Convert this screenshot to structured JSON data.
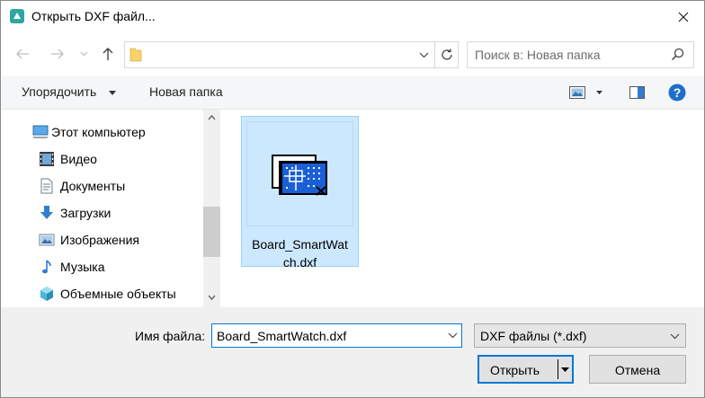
{
  "window": {
    "title": "Открыть DXF файл..."
  },
  "navigation": {
    "search_placeholder": "Поиск в: Новая папка"
  },
  "toolbar": {
    "organize_label": "Упорядочить",
    "new_folder_label": "Новая папка"
  },
  "sidebar": {
    "items": [
      {
        "label": "Этот компьютер",
        "icon": "computer-icon"
      },
      {
        "label": "Видео",
        "icon": "video-icon"
      },
      {
        "label": "Документы",
        "icon": "documents-icon"
      },
      {
        "label": "Загрузки",
        "icon": "downloads-icon"
      },
      {
        "label": "Изображения",
        "icon": "pictures-icon"
      },
      {
        "label": "Музыка",
        "icon": "music-icon"
      },
      {
        "label": "Объемные объекты",
        "icon": "3d-objects-icon"
      }
    ]
  },
  "files": [
    {
      "name": "Board_SmartWatch.dxf",
      "display_lines": [
        "Board_SmartWat",
        "ch.dxf"
      ],
      "selected": true
    }
  ],
  "footer": {
    "filename_label": "Имя файла:",
    "filename_value": "Board_SmartWatch.dxf",
    "filter_value": "DXF файлы (*.dxf)",
    "open_label": "Открыть",
    "cancel_label": "Отмена"
  },
  "colors": {
    "accent": "#0078d7",
    "selection_bg": "#cce8ff",
    "selection_border": "#99d1ff",
    "help_blue": "#1e6fc9"
  }
}
